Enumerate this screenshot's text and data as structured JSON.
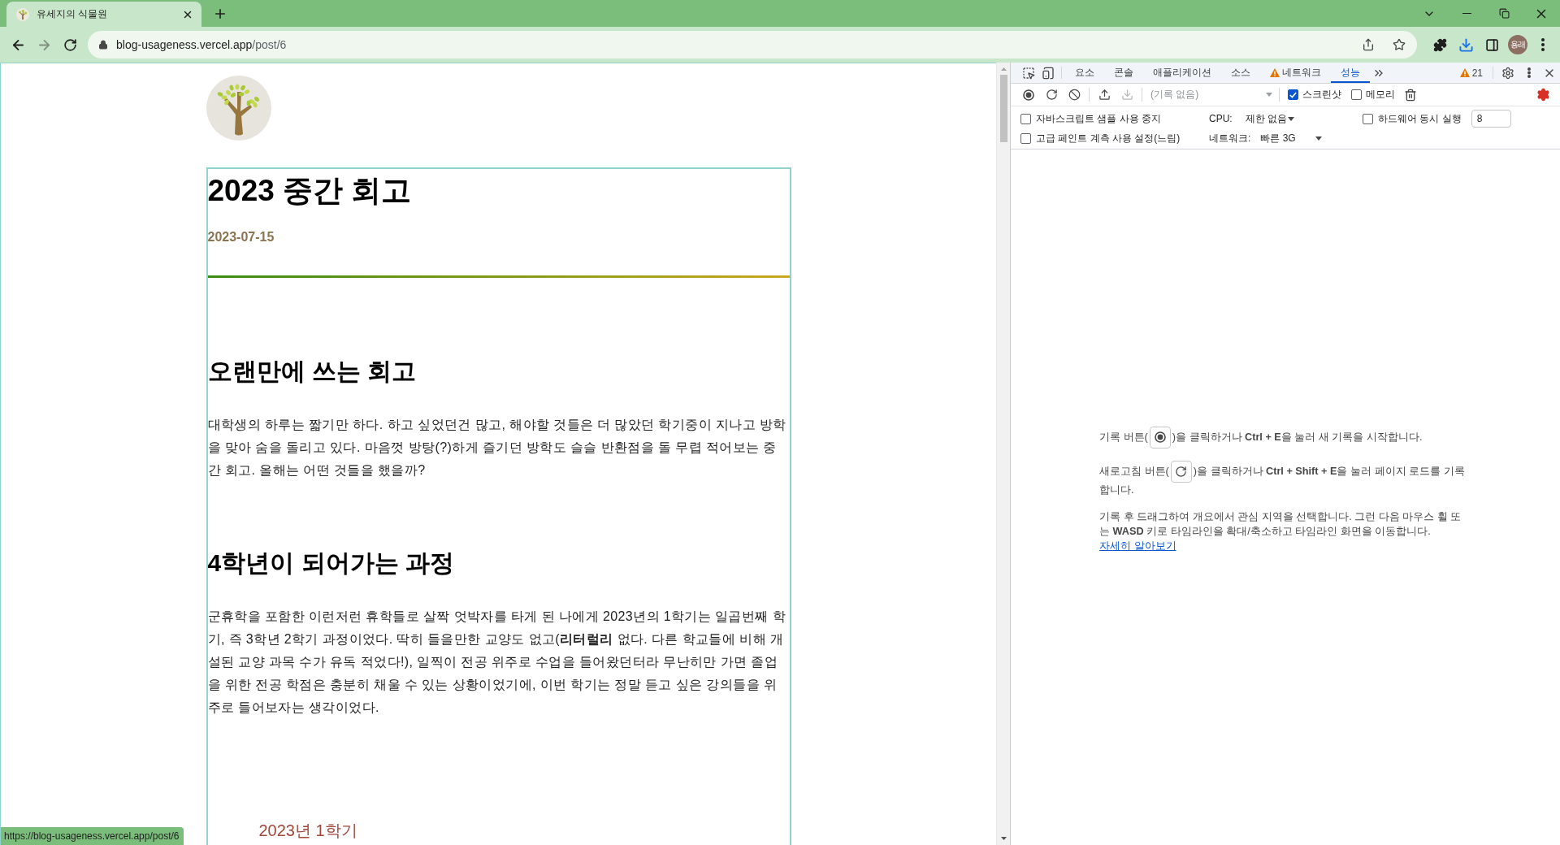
{
  "browser": {
    "tabs": [
      {
        "title": "유세지의 식물원",
        "selected": true
      }
    ],
    "forward": {
      "disabled": true
    },
    "address": {
      "host": "blog-usageness.vercel.app",
      "path": "/post/6"
    },
    "profile": {
      "initials": "용래"
    }
  },
  "page": {
    "title": "2023 중간 회고",
    "date": "2023-07-15",
    "sections": [
      {
        "heading": "오랜만에 쓰는 회고",
        "paragraphs": [
          "대학생의 하루는 짧기만 하다. 하고 싶었던건 많고, 해야할 것들은 더 많았던 학기중이 지나고 방학을 맞아 숨을 돌리고 있다. 마음껏 방탕(?)하게 즐기던 방학도 슬슬 반환점을 돌 무렵 적어보는 중간 회고. 올해는 어떤 것들을 했을까?"
        ]
      },
      {
        "heading": "4학년이 되어가는 과정",
        "paragraphs": [
          "군휴학을 포함한 이런저런 휴학들로 살짝 엇박자를 타게 된 나에게 2023년의 1학기는 일곱번째 학기, 즉 3학년 2학기 과정이었다. 딱히 들을만한 교양도 없고(**리터럴리** 없다. 다른 학교들에 비해 개설된 교양 과목 수가 유독 적었다!), 일찍이 전공 위주로 수업을 들어왔던터라 무난히만 가면 졸업을 위한 전공 학점은 충분히 채울 수 있는 상황이었기에, 이번 학기는 정말 듣고 싶은 강의들을 위주로 들어보자는 생각이었다."
        ]
      }
    ],
    "subheading": "2023년 1학기",
    "status_url": "https://blog-usageness.vercel.app/post/6"
  },
  "devtools": {
    "tabs": [
      {
        "label": "요소",
        "selected": false,
        "warning": false
      },
      {
        "label": "콘솔",
        "selected": false,
        "warning": false
      },
      {
        "label": "애플리케이션",
        "selected": false,
        "warning": false
      },
      {
        "label": "소스",
        "selected": false,
        "warning": false
      },
      {
        "label": "네트워크",
        "selected": false,
        "warning": true
      },
      {
        "label": "성능",
        "selected": true,
        "warning": false
      }
    ],
    "issues": "21",
    "toolbar": {
      "download_disabled": true,
      "recording": {
        "placeholder": "(기록 없음)"
      },
      "options": [
        {
          "label": "스크린샷",
          "checked": true
        },
        {
          "label": "메모리",
          "checked": false
        }
      ]
    },
    "settings": {
      "js_samples": {
        "label": "자바스크립트 샘플 사용 중지",
        "checked": false
      },
      "cpu": {
        "label": "CPU:",
        "value": "제한 없음"
      },
      "concurrency": {
        "label": "하드웨어 동시 실행",
        "checked": false,
        "value": "8"
      },
      "paint": {
        "label": "고급 페인트 계측 사용 설정(느림)",
        "checked": false
      },
      "network": {
        "label": "네트워크:",
        "value": "빠른 3G"
      }
    },
    "instructions": [
      {
        "kind": "record",
        "before": "기록 버튼(",
        "after": ")을 클릭하거나 **Ctrl + E**을 눌러 새 기록을 시작합니다."
      },
      {
        "kind": "reload",
        "before": "새로고침 버튼(",
        "after": ")을 클릭하거나 **Ctrl + Shift + E**을 눌러 페이지 로드를 기록합니다."
      },
      {
        "kind": "text",
        "text": "기록 후 드래그하여 개요에서 관심 지역을 선택합니다. 그런 다음 마우스 휠 또는 **WASD** 키로 타임라인을 확대/축소하고 타임라인 화면을 이동합니다.",
        "link": "자세히 알아보기"
      }
    ]
  }
}
